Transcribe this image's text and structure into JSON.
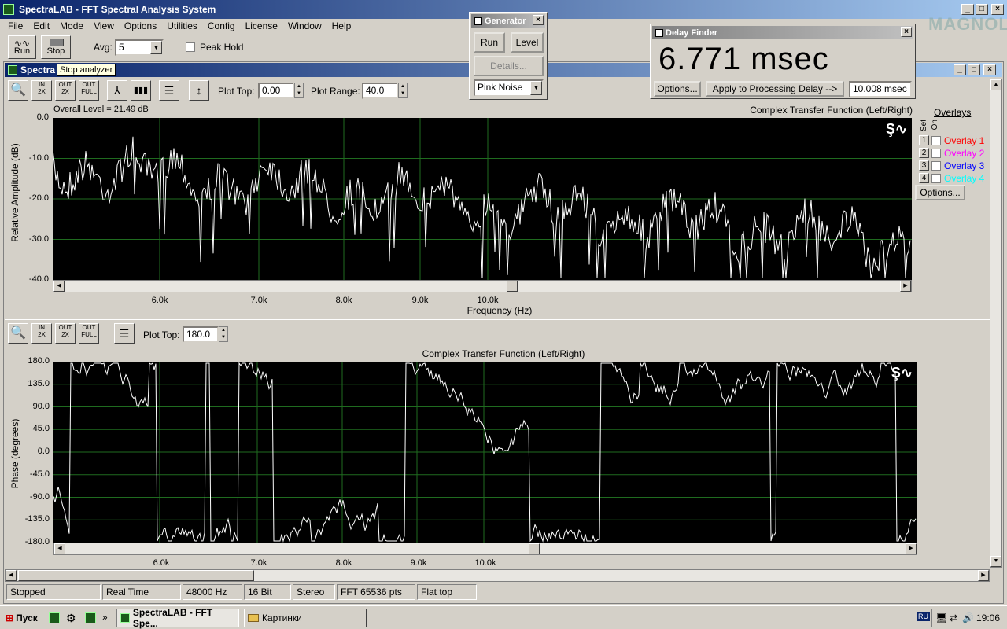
{
  "app": {
    "title": "SpectraLAB - FFT Spectral Analysis System",
    "inner_title": "Spectra"
  },
  "menu": [
    "File",
    "Edit",
    "Mode",
    "View",
    "Options",
    "Utilities",
    "Config",
    "License",
    "Window",
    "Help"
  ],
  "toolbar": {
    "run": "Run",
    "stop": "Stop",
    "avg_label": "Avg:",
    "avg_value": "5",
    "peak_hold": "Peak Hold",
    "tooltip": "Stop analyzer"
  },
  "generator": {
    "title": "Generator",
    "run": "Run",
    "level": "Level",
    "details": "Details...",
    "noise": "Pink Noise"
  },
  "delay": {
    "title": "Delay Finder",
    "value": "6.771 msec",
    "options": "Options...",
    "apply": "Apply to Processing Delay -->",
    "field": "10.008 msec"
  },
  "plot1": {
    "plot_top_label": "Plot Top:",
    "plot_top": "0.00",
    "range_label": "Plot Range:",
    "range": "40.0",
    "overall": "Overall Level = 21.49 dB",
    "title": "Complex Transfer Function (Left/Right)",
    "ylabel": "Relative Amplitude (dB)",
    "xlabel": "Frequency (Hz)",
    "yticks": [
      "0.0",
      "-10.0",
      "-20.0",
      "-30.0",
      "-40.0"
    ],
    "xticks": [
      "6.0k",
      "7.0k",
      "8.0k",
      "9.0k",
      "10.0k"
    ]
  },
  "overlays": {
    "header": "Overlays",
    "set": "Set",
    "on": "On",
    "items": [
      {
        "n": "1",
        "label": "Overlay 1",
        "color": "#ff0000"
      },
      {
        "n": "2",
        "label": "Overlay 2",
        "color": "#ff00ff"
      },
      {
        "n": "3",
        "label": "Overlay 3",
        "color": "#0000ff"
      },
      {
        "n": "4",
        "label": "Overlay 4",
        "color": "#00ffff"
      }
    ],
    "options": "Options..."
  },
  "plot2": {
    "plot_top_label": "Plot Top:",
    "plot_top": "180.0",
    "title": "Complex Transfer Function (Left/Right)",
    "ylabel": "Phase (degrees)",
    "yticks": [
      "180.0",
      "135.0",
      "90.0",
      "45.0",
      "0.0",
      "-45.0",
      "-90.0",
      "-135.0",
      "-180.0"
    ],
    "xticks": [
      "6.0k",
      "7.0k",
      "8.0k",
      "9.0k",
      "10.0k"
    ]
  },
  "status": [
    "Stopped",
    "Real Time",
    "48000 Hz",
    "16 Bit",
    "Stereo",
    "FFT 65536 pts",
    "Flat top"
  ],
  "taskbar": {
    "start": "Пуск",
    "task1": "SpectraLAB - FFT Spe...",
    "task2": "Картинки",
    "lang": "RU",
    "clock": "19:06"
  },
  "watermark": "MAGNOLA"
}
